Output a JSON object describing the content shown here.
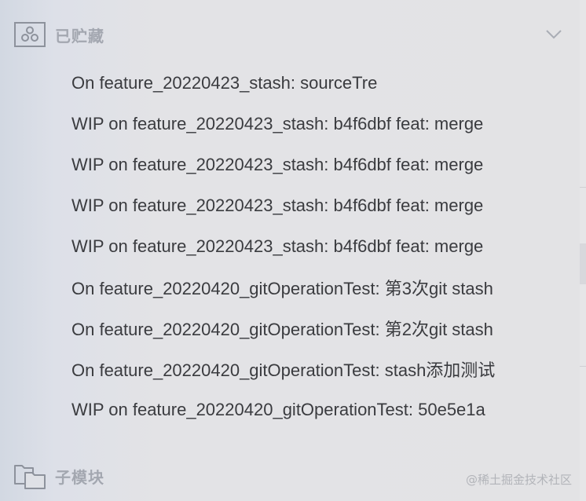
{
  "stashes": {
    "title": "已贮藏",
    "icon": "stash-icon",
    "toggle_icon": "chevron-down-icon",
    "items": [
      {
        "label": "On feature_20220423_stash: sourceTre"
      },
      {
        "label": "WIP on feature_20220423_stash: b4f6dbf feat: merge"
      },
      {
        "label": "WIP on feature_20220423_stash: b4f6dbf feat: merge"
      },
      {
        "label": "WIP on feature_20220423_stash: b4f6dbf feat: merge"
      },
      {
        "label": "WIP on feature_20220423_stash: b4f6dbf feat: merge"
      },
      {
        "label": "On feature_20220420_gitOperationTest: 第3次git stash"
      },
      {
        "label": "On feature_20220420_gitOperationTest: 第2次git stash"
      },
      {
        "label": "On feature_20220420_gitOperationTest: stash添加测试"
      },
      {
        "label": "WIP on feature_20220420_gitOperationTest: 50e5e1a"
      }
    ]
  },
  "submodules": {
    "title": "子模块",
    "icon": "submodule-folder-icon"
  },
  "watermark": "@稀土掘金技术社区"
}
